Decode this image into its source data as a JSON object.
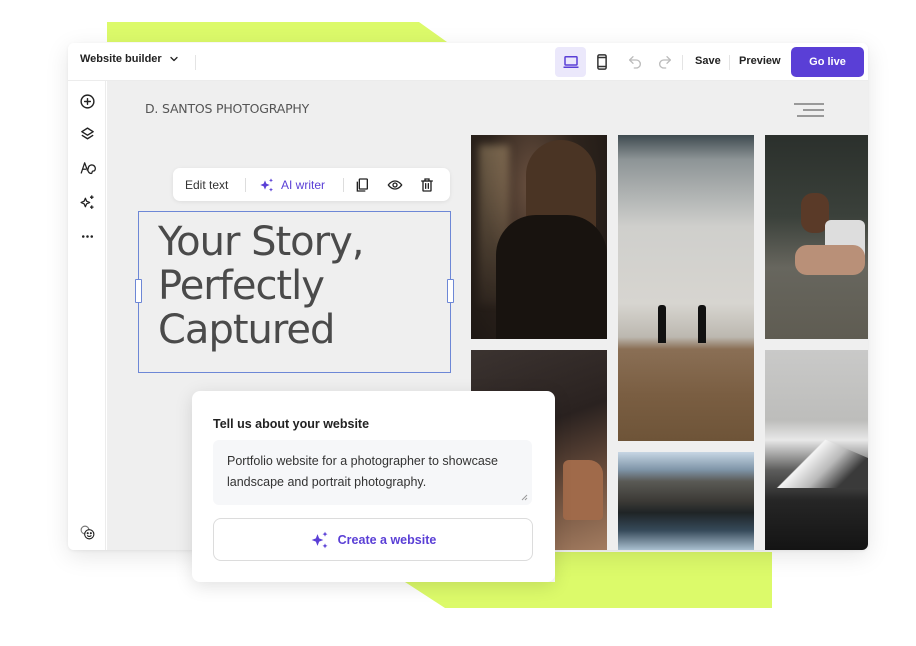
{
  "colors": {
    "accent_lime": "#dcfa6a",
    "brand_purple": "#5a3fd6",
    "selection_blue": "#6d87d6",
    "canvas_bg": "#efefef"
  },
  "topbar": {
    "project_dropdown_label": "Website builder",
    "device_modes": [
      {
        "name": "desktop",
        "icon": "laptop-icon",
        "active": true
      },
      {
        "name": "mobile",
        "icon": "mobile-icon",
        "active": false
      }
    ],
    "undo_icon": "undo-icon",
    "redo_icon": "redo-icon",
    "save_label": "Save",
    "preview_label": "Preview",
    "go_live_label": "Go live"
  },
  "sidebar": {
    "items": [
      {
        "name": "add",
        "icon": "plus-circle-icon"
      },
      {
        "name": "layers",
        "icon": "layers-icon"
      },
      {
        "name": "styles",
        "icon": "palette-icon"
      },
      {
        "name": "ai-tools",
        "icon": "sparkles-icon"
      },
      {
        "name": "more",
        "icon": "more-icon"
      }
    ],
    "bottom_item": {
      "name": "help",
      "icon": "smileys-icon"
    }
  },
  "site": {
    "logo_text": "D. SANTOS PHOTOGRAPHY",
    "headline": "Your Story, Perfectly Captured",
    "photos": [
      {
        "alt": "Portrait of woman with long curly hair in black coat"
      },
      {
        "alt": "Two surfers walking on beach toward the sea"
      },
      {
        "alt": "Woman crouching in a field"
      },
      {
        "alt": "Red rock canyon landscape"
      },
      {
        "alt": "Mountain lake reflection"
      },
      {
        "alt": "Snowy mountain peak"
      }
    ]
  },
  "text_toolbar": {
    "edit_text_label": "Edit text",
    "ai_writer_label": "AI writer",
    "duplicate_icon": "copy-icon",
    "visibility_icon": "eye-icon",
    "delete_icon": "trash-icon"
  },
  "prompt_card": {
    "title": "Tell us about your website",
    "input_value": "Portfolio website for a photographer to showcase landscape and portrait photography.",
    "create_button_label": "Create a website"
  }
}
